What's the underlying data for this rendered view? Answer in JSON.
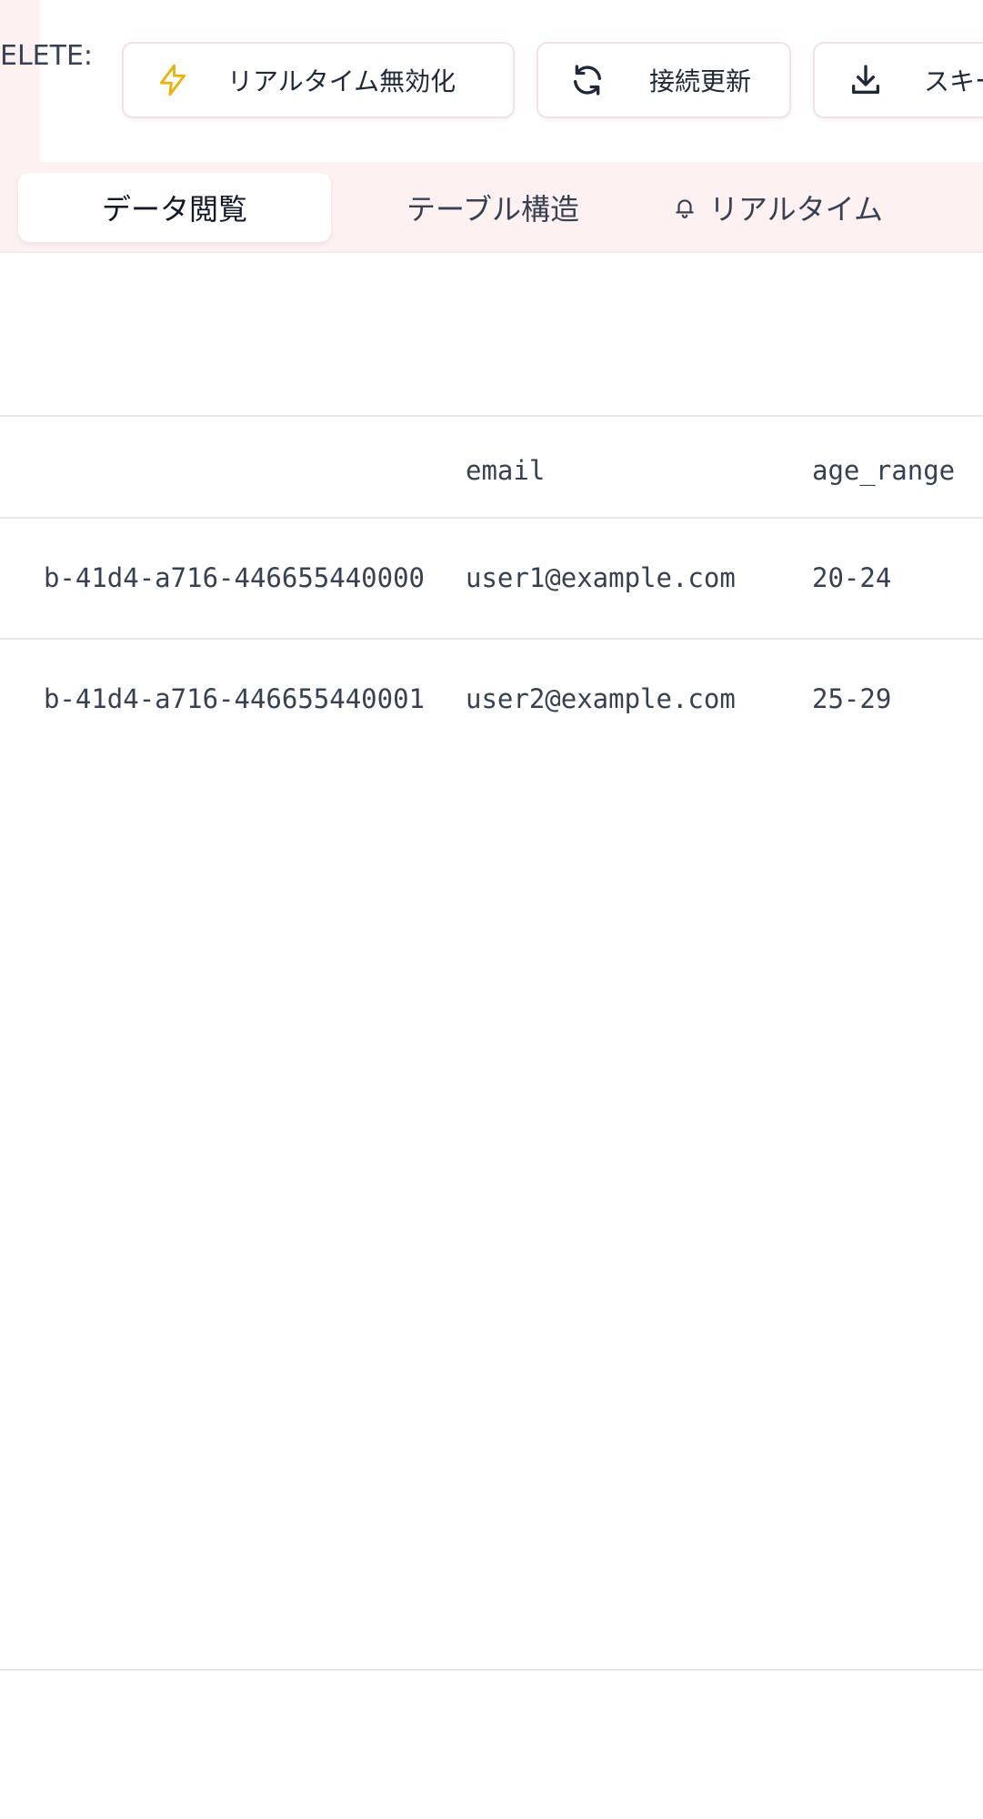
{
  "toolbar": {
    "delete_label": "ELETE:",
    "realtime_disable_label": "リアルタイム無効化",
    "refresh_connection_label": "接続更新",
    "export_schema_label": "スキー",
    "colors": {
      "bolt_icon": "#eab308",
      "border": "#f1e3e3",
      "tint": "#fdf1f1"
    }
  },
  "tabs": [
    {
      "label": "データ閲覧",
      "active": true
    },
    {
      "label": "テーブル構造",
      "active": false
    },
    {
      "label": "リアルタイム",
      "active": false,
      "icon": "bell-icon"
    }
  ],
  "table": {
    "columns": [
      "",
      "email",
      "age_range"
    ],
    "rows": [
      {
        "id": "b-41d4-a716-446655440000",
        "email": "user1@example.com",
        "age_range": "20-24"
      },
      {
        "id": "b-41d4-a716-446655440001",
        "email": "user2@example.com",
        "age_range": "25-29"
      }
    ]
  }
}
